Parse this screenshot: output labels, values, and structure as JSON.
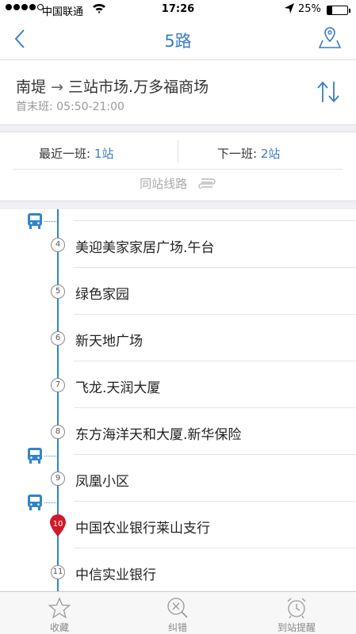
{
  "status_bar": {
    "carrier": "中国联通",
    "time": "17:26",
    "battery": "25%",
    "battery_level": 0.25
  },
  "nav": {
    "title": "5路"
  },
  "route": {
    "from": "南堤",
    "arrow": "→",
    "to": "三站市场.万多福商场",
    "hours": "首末班: 05:50-21:00"
  },
  "summary": {
    "nearest_label": "最近一班:",
    "nearest_value": "1站",
    "next_label": "下一班:",
    "next_value": "2站",
    "same_station": "同站线路"
  },
  "stops": [
    {
      "num": "4",
      "name": "美迎美家家居广场.午台"
    },
    {
      "num": "5",
      "name": "绿色家园"
    },
    {
      "num": "6",
      "name": "新天地广场"
    },
    {
      "num": "7",
      "name": "飞龙.天润大厦"
    },
    {
      "num": "8",
      "name": "东方海洋天和大厦.新华保险"
    },
    {
      "num": "9",
      "name": "凤凰小区"
    },
    {
      "num": "10",
      "name": "中国农业银行莱山支行"
    },
    {
      "num": "11",
      "name": "中信实业银行"
    }
  ],
  "tabs": [
    {
      "label": "收藏",
      "icon": "star-icon"
    },
    {
      "label": "纠错",
      "icon": "magnifier-x-icon"
    },
    {
      "label": "到站提醒",
      "icon": "alarm-clock-icon"
    }
  ],
  "colors": {
    "accent": "#3a7cc4",
    "timeline": "#2f86c9",
    "current_stop": "#d0192a"
  }
}
